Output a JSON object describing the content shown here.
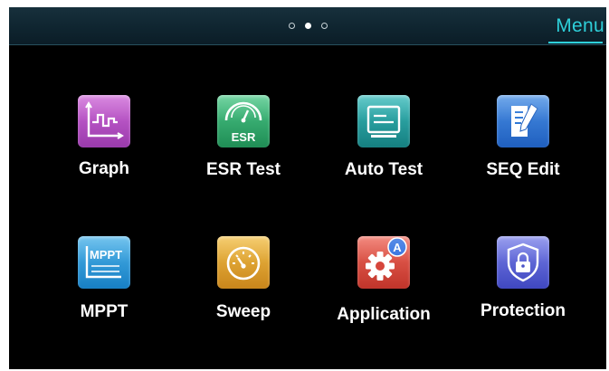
{
  "header": {
    "pages": [
      "page-1",
      "page-2",
      "page-3"
    ],
    "active_page": 2,
    "menu_label": "Menu",
    "accent_color": "#2ecfd9"
  },
  "apps": [
    {
      "label": "Graph",
      "icon": "graph-icon",
      "color": "#b04ec2"
    },
    {
      "label": "ESR Test",
      "icon": "esr-gauge-icon",
      "color": "#2fa86a"
    },
    {
      "label": "Auto Test",
      "icon": "auto-test-screen-icon",
      "color": "#1a9a9a"
    },
    {
      "label": "SEQ Edit",
      "icon": "edit-document-icon",
      "color": "#2f78d6"
    },
    {
      "label": "MPPT",
      "icon": "mppt-icon",
      "color": "#1f93d6"
    },
    {
      "label": "Sweep",
      "icon": "speedometer-icon",
      "color": "#e0a12a"
    },
    {
      "label": "Application",
      "icon": "gear-badge-a-icon",
      "color": "#d6463c"
    },
    {
      "label": "Protection",
      "icon": "shield-lock-icon",
      "color": "#5a63d8"
    }
  ],
  "icon_text": {
    "esr": "ESR",
    "mppt": "MPPT",
    "badge": "A"
  }
}
